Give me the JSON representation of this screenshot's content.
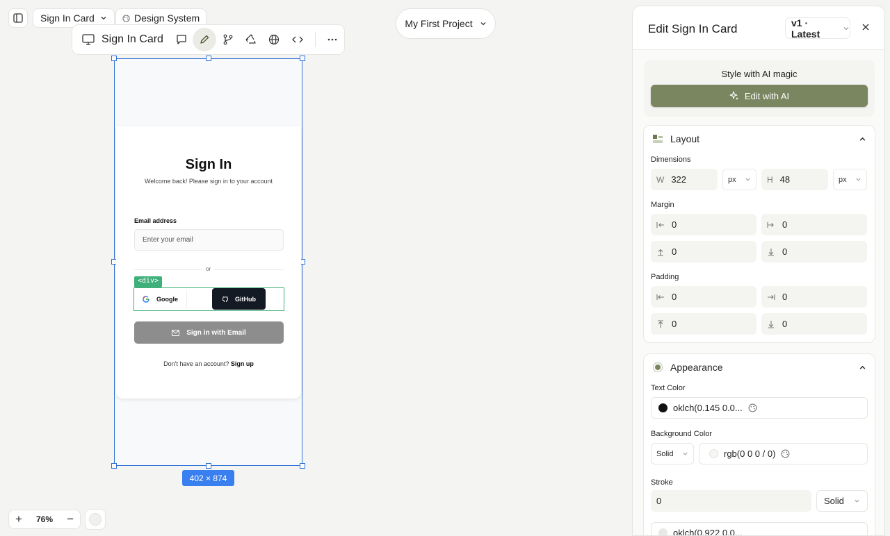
{
  "topbar": {
    "page_select": "Sign In Card",
    "design_system": "Design System",
    "project": "My First Project"
  },
  "toolbar": {
    "title": "Sign In Card"
  },
  "canvas": {
    "size_badge": "402 × 874",
    "element_tag": "<div>",
    "zoom": "76%"
  },
  "card": {
    "title": "Sign In",
    "subtitle": "Welcome back! Please sign in to your account",
    "email_label": "Email address",
    "email_placeholder": "Enter your email",
    "divider": "or",
    "google": "Google",
    "github": "GitHub",
    "signin_email": "Sign in with Email",
    "footer_text": "Don't have an account?",
    "footer_link": "Sign up"
  },
  "panel": {
    "title": "Edit Sign In Card",
    "version": "v1 · Latest",
    "ai_prompt": "Style with AI magic",
    "ai_button": "Edit with AI",
    "layout": {
      "heading": "Layout",
      "dimensions_label": "Dimensions",
      "w_prefix": "W",
      "w_value": "322",
      "w_unit": "px",
      "h_prefix": "H",
      "h_value": "48",
      "h_unit": "px",
      "margin_label": "Margin",
      "margin": [
        "0",
        "0",
        "0",
        "0"
      ],
      "padding_label": "Padding",
      "padding": [
        "0",
        "0",
        "0",
        "0"
      ]
    },
    "appearance": {
      "heading": "Appearance",
      "text_color_label": "Text Color",
      "text_color_value": "oklch(0.145 0.0...",
      "bg_label": "Background Color",
      "bg_mode": "Solid",
      "bg_value": "rgb(0 0 0 / 0)",
      "stroke_label": "Stroke",
      "stroke_value": "0",
      "stroke_style": "Solid",
      "stroke_color_value": "oklch(0.922 0.0..."
    }
  },
  "colors": {
    "accent_green": "#7a8660",
    "selection_blue": "#2f6fd6",
    "tag_green": "#3fb07a"
  }
}
